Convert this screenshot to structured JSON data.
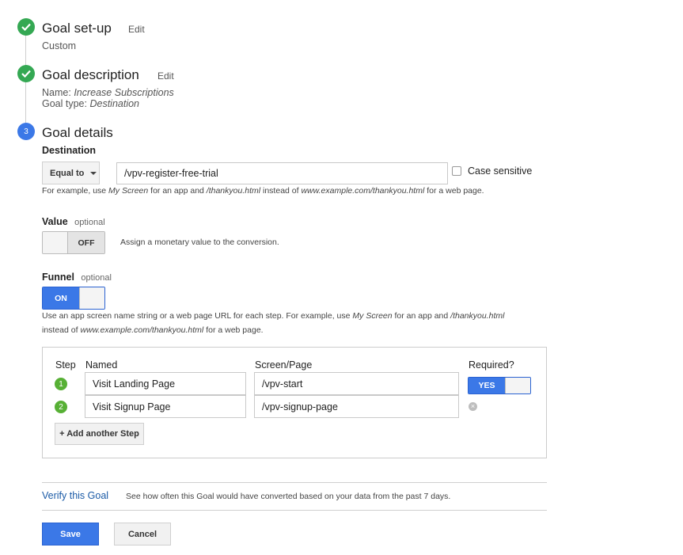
{
  "steps": {
    "setup": {
      "title": "Goal set-up",
      "edit": "Edit",
      "value": "Custom"
    },
    "description": {
      "title": "Goal description",
      "edit": "Edit",
      "name_label": "Name:",
      "name_value": "Increase Subscriptions",
      "type_label": "Goal type:",
      "type_value": "Destination"
    },
    "details": {
      "number": "3",
      "title": "Goal details"
    }
  },
  "destination": {
    "label": "Destination",
    "match_type": "Equal to",
    "value": "/vpv-register-free-trial",
    "case_sensitive_label": "Case sensitive",
    "hint": {
      "p1": "For example, use ",
      "i1": "My Screen",
      "p2": " for an app and ",
      "i2": "/thankyou.html",
      "p3": " instead of ",
      "i3": "www.example.com/thankyou.html",
      "p4": " for a web page."
    }
  },
  "value": {
    "label": "Value",
    "optional": "optional",
    "toggle_state": "OFF",
    "description": "Assign a monetary value to the conversion."
  },
  "funnel": {
    "label": "Funnel",
    "optional": "optional",
    "toggle_state": "ON",
    "hint": {
      "p1": "Use an app screen name string or a web page URL for each step. For example, use ",
      "i1": "My Screen",
      "p2": " for an app and ",
      "i2": "/thankyou.html",
      "line2_p1": "instead of ",
      "line2_i1": "www.example.com/thankyou.html",
      "line2_p2": " for a web page."
    },
    "columns": {
      "step": "Step",
      "named": "Named",
      "screen": "Screen/Page",
      "required": "Required?"
    },
    "rows": [
      {
        "step": "1",
        "name": "Visit Landing Page",
        "screen": "/vpv-start"
      },
      {
        "step": "2",
        "name": "Visit Signup Page",
        "screen": "/vpv-signup-page"
      }
    ],
    "required_toggle": "YES",
    "add_step": "+ Add another Step"
  },
  "verify": {
    "link": "Verify this Goal",
    "description": "See how often this Goal would have converted based on your data from the past 7 days."
  },
  "actions": {
    "save": "Save",
    "cancel": "Cancel"
  },
  "colors": {
    "accent": "#3b78e7",
    "check": "#34a853",
    "step": "#57b035"
  }
}
